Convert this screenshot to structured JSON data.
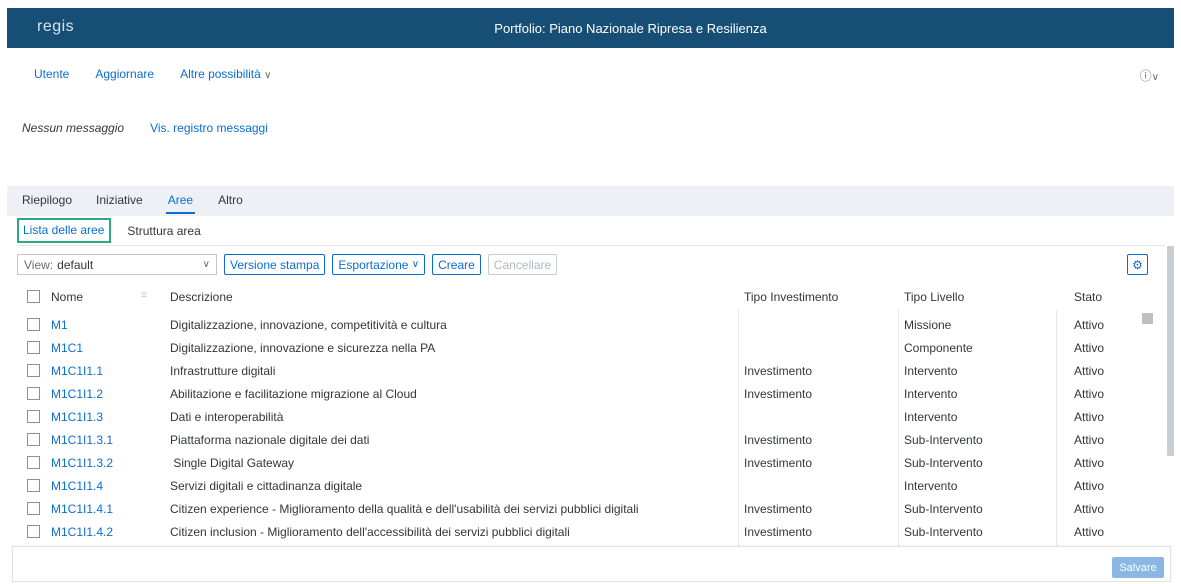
{
  "shell": {
    "logo": "regis",
    "title": "Portfolio: Piano Nazionale Ripresa e Resilienza"
  },
  "menu": {
    "items": [
      "Utente",
      "Aggiornare",
      "Altre possibilità"
    ],
    "help_icon": "help-icon"
  },
  "messages": {
    "status": "Nessun messaggio",
    "link": "Vis. registro messaggi"
  },
  "tabs": {
    "items": [
      "Riepilogo",
      "Iniziative",
      "Aree",
      "Altro"
    ],
    "active": "Aree"
  },
  "subtabs": {
    "items": [
      "Lista delle aree",
      "Struttura area"
    ],
    "active": "Lista delle aree"
  },
  "toolbar": {
    "view_label": "View:",
    "view_value": "default",
    "buttons": [
      "Versione stampa",
      "Esportazione",
      "Creare",
      "Cancellare"
    ]
  },
  "table": {
    "columns": [
      "Nome",
      "Descrizione",
      "Tipo Investimento",
      "Tipo Livello",
      "Stato"
    ],
    "rows": [
      [
        "M1",
        "Digitalizzazione, innovazione, competitività e cultura",
        "",
        "Missione",
        "Attivo"
      ],
      [
        "M1C1",
        "Digitalizzazione, innovazione e sicurezza nella PA",
        "",
        "Componente",
        "Attivo"
      ],
      [
        "M1C1I1.1",
        "Infrastrutture digitali",
        "Investimento",
        "Intervento",
        "Attivo"
      ],
      [
        "M1C1I1.2",
        "Abilitazione e facilitazione migrazione al Cloud",
        "Investimento",
        "Intervento",
        "Attivo"
      ],
      [
        "M1C1I1.3",
        "Dati e interoperabilità",
        "",
        "Intervento",
        "Attivo"
      ],
      [
        "M1C1I1.3.1",
        "Piattaforma nazionale digitale dei dati",
        "Investimento",
        "Sub-Intervento",
        "Attivo"
      ],
      [
        "M1C1I1.3.2",
        " Single Digital Gateway",
        "Investimento",
        "Sub-Intervento",
        "Attivo"
      ],
      [
        "M1C1I1.4",
        "Servizi digitali e cittadinanza digitale",
        "",
        "Intervento",
        "Attivo"
      ],
      [
        "M1C1I1.4.1",
        "Citizen experience - Miglioramento della qualità e dell'usabilità dei servizi pubblici digitali",
        "Investimento",
        "Sub-Intervento",
        "Attivo"
      ],
      [
        "M1C1I1.4.2",
        "Citizen inclusion - Miglioramento dell'accessibilità dei servizi pubblici digitali",
        "Investimento",
        "Sub-Intervento",
        "Attivo"
      ]
    ]
  },
  "footer": {
    "save_label": "Salvare"
  },
  "colors": {
    "shell_bg": "#164e75",
    "link": "#0a6ed1",
    "focus_border": "#2aa982"
  }
}
